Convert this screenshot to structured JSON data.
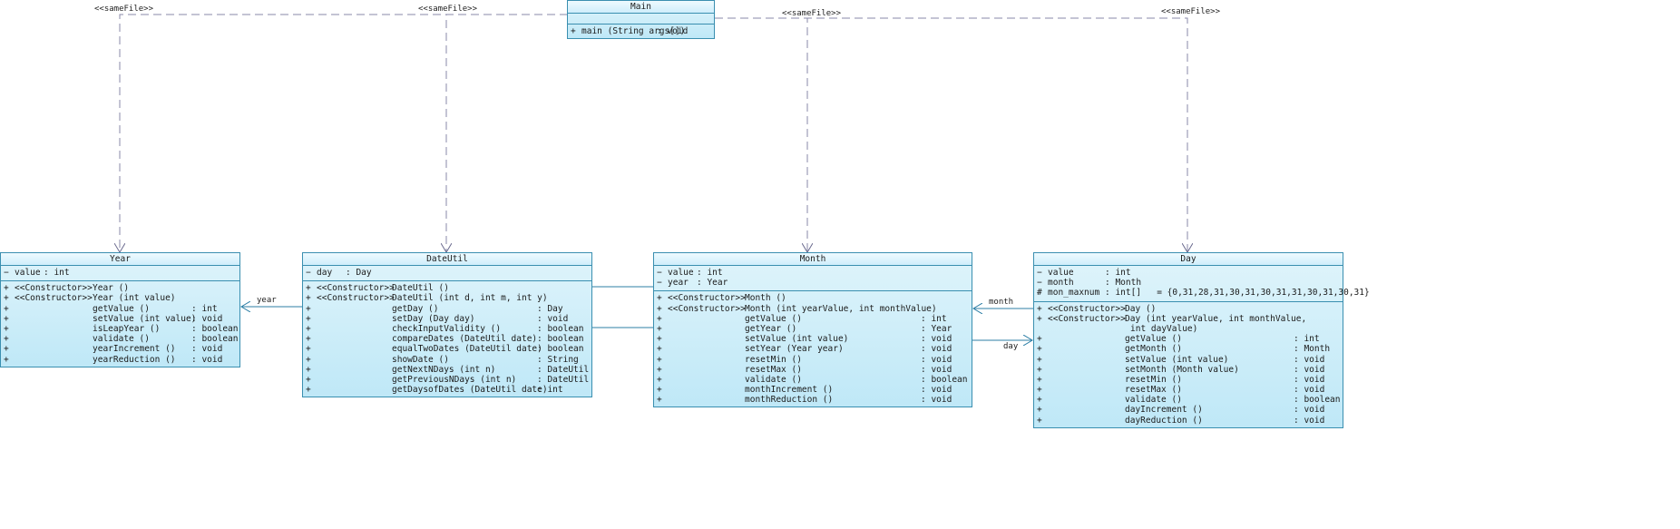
{
  "stereotype_label": "<<sameFile>>",
  "classes": {
    "main": {
      "title": "Main",
      "attrs": [],
      "ops": [
        {
          "vis": "+",
          "stereo": "",
          "name": "main (String args[])",
          "type": ": void"
        }
      ]
    },
    "year": {
      "title": "Year",
      "attrs": [
        {
          "vis": "−",
          "name": "value",
          "type": ": int"
        }
      ],
      "ops": [
        {
          "vis": "+",
          "stereo": "<<Constructor>>",
          "name": "Year ()",
          "type": ""
        },
        {
          "vis": "+",
          "stereo": "<<Constructor>>",
          "name": "Year (int value)",
          "type": ""
        },
        {
          "vis": "+",
          "stereo": "",
          "name": "getValue ()",
          "type": ": int"
        },
        {
          "vis": "+",
          "stereo": "",
          "name": "setValue (int value)",
          "type": ": void"
        },
        {
          "vis": "+",
          "stereo": "",
          "name": "isLeapYear ()",
          "type": ": boolean"
        },
        {
          "vis": "+",
          "stereo": "",
          "name": "validate ()",
          "type": ": boolean"
        },
        {
          "vis": "+",
          "stereo": "",
          "name": "yearIncrement ()",
          "type": ": void"
        },
        {
          "vis": "+",
          "stereo": "",
          "name": "yearReduction ()",
          "type": ": void"
        }
      ]
    },
    "dateutil": {
      "title": "DateUtil",
      "attrs": [
        {
          "vis": "−",
          "name": "day",
          "type": ": Day"
        }
      ],
      "ops": [
        {
          "vis": "+",
          "stereo": "<<Constructor>>",
          "name": "DateUtil ()",
          "type": ""
        },
        {
          "vis": "+",
          "stereo": "<<Constructor>>",
          "name": "DateUtil (int d, int m, int y)",
          "type": ""
        },
        {
          "vis": "+",
          "stereo": "",
          "name": "getDay ()",
          "type": ": Day"
        },
        {
          "vis": "+",
          "stereo": "",
          "name": "setDay (Day day)",
          "type": ": void"
        },
        {
          "vis": "+",
          "stereo": "",
          "name": "checkInputValidity ()",
          "type": ": boolean"
        },
        {
          "vis": "+",
          "stereo": "",
          "name": "compareDates (DateUtil date)",
          "type": ": boolean"
        },
        {
          "vis": "+",
          "stereo": "",
          "name": "equalTwoDates (DateUtil date)",
          "type": ": boolean"
        },
        {
          "vis": "+",
          "stereo": "",
          "name": "showDate ()",
          "type": ": String"
        },
        {
          "vis": "+",
          "stereo": "",
          "name": "getNextNDays (int n)",
          "type": ": DateUtil"
        },
        {
          "vis": "+",
          "stereo": "",
          "name": "getPreviousNDays (int n)",
          "type": ": DateUtil"
        },
        {
          "vis": "+",
          "stereo": "",
          "name": "getDaysofDates (DateUtil date)",
          "type": ": int"
        }
      ]
    },
    "month": {
      "title": "Month",
      "attrs": [
        {
          "vis": "−",
          "name": "value",
          "type": ": int"
        },
        {
          "vis": "−",
          "name": "year",
          "type": ": Year"
        }
      ],
      "ops": [
        {
          "vis": "+",
          "stereo": "<<Constructor>>",
          "name": "Month ()",
          "type": ""
        },
        {
          "vis": "+",
          "stereo": "<<Constructor>>",
          "name": "Month (int yearValue, int monthValue)",
          "type": ""
        },
        {
          "vis": "+",
          "stereo": "",
          "name": "getValue ()",
          "type": ": int"
        },
        {
          "vis": "+",
          "stereo": "",
          "name": "getYear ()",
          "type": ": Year"
        },
        {
          "vis": "+",
          "stereo": "",
          "name": "setValue (int value)",
          "type": ": void"
        },
        {
          "vis": "+",
          "stereo": "",
          "name": "setYear (Year year)",
          "type": ": void"
        },
        {
          "vis": "+",
          "stereo": "",
          "name": "resetMin ()",
          "type": ": void"
        },
        {
          "vis": "+",
          "stereo": "",
          "name": "resetMax ()",
          "type": ": void"
        },
        {
          "vis": "+",
          "stereo": "",
          "name": "validate ()",
          "type": ": boolean"
        },
        {
          "vis": "+",
          "stereo": "",
          "name": "monthIncrement ()",
          "type": ": void"
        },
        {
          "vis": "+",
          "stereo": "",
          "name": "monthReduction ()",
          "type": ": void"
        }
      ]
    },
    "day": {
      "title": "Day",
      "attrs": [
        {
          "vis": "−",
          "name": "value",
          "type": ": int"
        },
        {
          "vis": "−",
          "name": "month",
          "type": ": Month"
        },
        {
          "vis": "#",
          "name": "mon_maxnum",
          "type": ": int[]   = {0,31,28,31,30,31,30,31,31,30,31,30,31}"
        }
      ],
      "ops": [
        {
          "vis": "+",
          "stereo": "<<Constructor>>",
          "name": "Day ()",
          "type": ""
        },
        {
          "vis": "+",
          "stereo": "<<Constructor>>",
          "name": "Day (int yearValue, int monthValue,",
          "type": ""
        },
        {
          "vis": "",
          "stereo": "",
          "name": "int dayValue)",
          "type": "",
          "indent": true
        },
        {
          "vis": "+",
          "stereo": "",
          "name": "getValue ()",
          "type": ": int"
        },
        {
          "vis": "+",
          "stereo": "",
          "name": "getMonth ()",
          "type": ": Month"
        },
        {
          "vis": "+",
          "stereo": "",
          "name": "setValue (int value)",
          "type": ": void"
        },
        {
          "vis": "+",
          "stereo": "",
          "name": "setMonth (Month value)",
          "type": ": void"
        },
        {
          "vis": "+",
          "stereo": "",
          "name": "resetMin ()",
          "type": ": void"
        },
        {
          "vis": "+",
          "stereo": "",
          "name": "resetMax ()",
          "type": ": void"
        },
        {
          "vis": "+",
          "stereo": "",
          "name": "validate ()",
          "type": ": boolean"
        },
        {
          "vis": "+",
          "stereo": "",
          "name": "dayIncrement ()",
          "type": ": void"
        },
        {
          "vis": "+",
          "stereo": "",
          "name": "dayReduction ()",
          "type": ": void"
        }
      ]
    }
  },
  "associations": {
    "year": "year",
    "month": "month",
    "day": "day"
  },
  "colors": {
    "border": "#3a8fb0",
    "fill": "#bfe8f7",
    "dependency_line": "#8a8aa8",
    "association_line": "#2d7fa6"
  }
}
